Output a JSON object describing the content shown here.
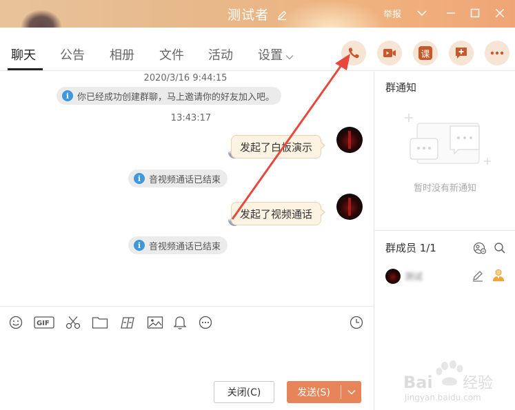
{
  "window": {
    "title": "测试者",
    "report_label": "举报"
  },
  "tabs": [
    {
      "label": "聊天",
      "active": true
    },
    {
      "label": "公告"
    },
    {
      "label": "相册"
    },
    {
      "label": "文件"
    },
    {
      "label": "活动"
    },
    {
      "label": "设置"
    }
  ],
  "header_actions": {
    "lesson_label": "课"
  },
  "chat": {
    "timestamps": [
      "2020/3/16 9:44:15",
      "13:43:17"
    ],
    "notices": [
      "你已经成功创建群聊，马上邀请你的好友加入吧。",
      "音视频通话已结束",
      "音视频通话已结束"
    ],
    "messages": [
      "发起了白板演示",
      "发起了视频通话"
    ]
  },
  "input": {
    "close_label": "关闭(C)",
    "send_label": "发送(S)"
  },
  "group_notice": {
    "title": "群通知",
    "empty_text": "暂时没有新通知"
  },
  "members": {
    "title": "群成员 1/1",
    "list": [
      {
        "name": "测试"
      }
    ]
  },
  "watermark": {
    "brand": "Bai 经验",
    "url": "jingyan.baidu.com"
  },
  "colors": {
    "accent": "#e8845a",
    "bubble_bg": "#fdf3e2",
    "action_circle": "#f6e4d5",
    "action_icon": "#c7582b",
    "arrow": "#e8473c",
    "info": "#3f97de"
  }
}
